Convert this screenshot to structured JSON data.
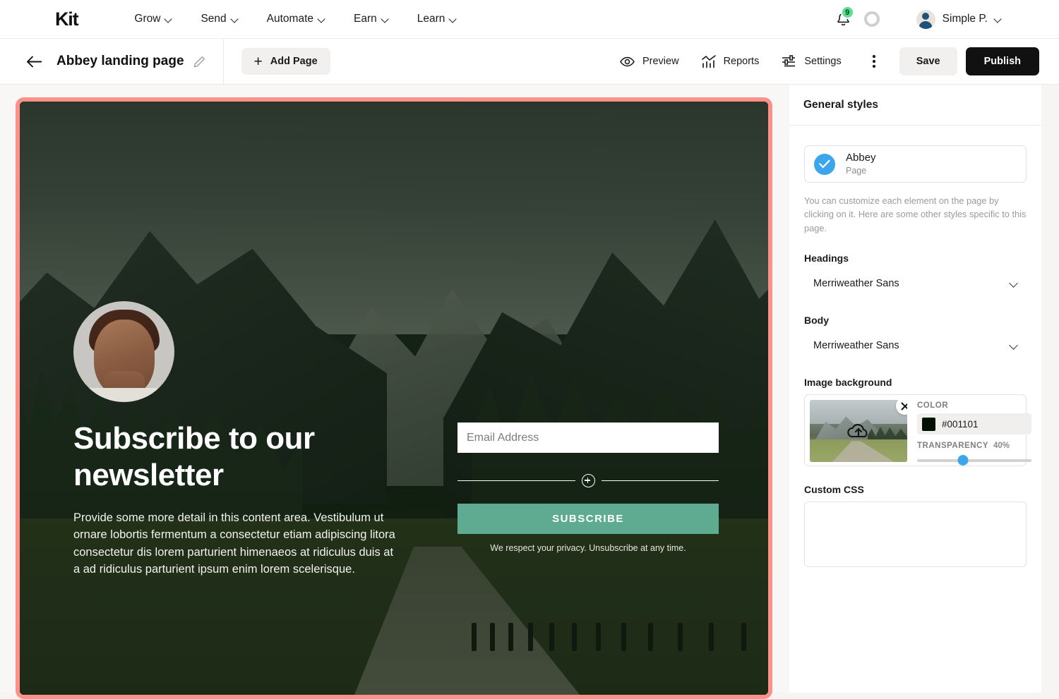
{
  "topnav": {
    "brand": "Kit",
    "menu": [
      {
        "label": "Grow",
        "icon": "chevron-down-icon"
      },
      {
        "label": "Send",
        "icon": "chevron-down-icon"
      },
      {
        "label": "Automate",
        "icon": "chevron-down-icon"
      },
      {
        "label": "Earn",
        "icon": "chevron-down-icon"
      },
      {
        "label": "Learn",
        "icon": "chevron-down-icon"
      }
    ],
    "notifications": {
      "icon": "bell-icon",
      "badge_count": "9",
      "badge_color": "#55e08e"
    },
    "progress_ring": {
      "icon": "progress-ring-icon"
    },
    "user": {
      "name": "Simple P.",
      "icon": "user-avatar-icon",
      "chevron": "chevron-down-icon"
    }
  },
  "subheader": {
    "back_icon": "back-arrow-icon",
    "page_title": "Abbey landing page",
    "edit_icon": "pencil-icon",
    "add_page_label": "Add Page",
    "add_page_icon": "plus-icon",
    "tools": [
      {
        "label": "Preview",
        "icon": "eye-icon"
      },
      {
        "label": "Reports",
        "icon": "bar-chart-icon"
      },
      {
        "label": "Settings",
        "icon": "sliders-icon"
      }
    ],
    "more_icon": "kebab-menu-icon",
    "save_label": "Save",
    "publish_label": "Publish"
  },
  "canvas": {
    "selection_color": "#fb9189",
    "hero": {
      "heading": "Subscribe to our newsletter",
      "body": "Provide some more detail in this content area. Vestibulum ut ornare lobortis fermentum a consectetur etiam adipiscing litora consectetur dis lorem parturient himenaeos at ridiculus duis at a ad ridiculus parturient ipsum enim lorem scelerisque.",
      "avatar_icon": "portrait-avatar-icon",
      "form": {
        "email_placeholder": "Email Address",
        "email_value": "",
        "add_field_icon": "plus-circle-icon",
        "submit_label": "SUBSCRIBE",
        "submit_color": "#5fab91",
        "privacy_text": "We respect your privacy. Unsubscribe at any time."
      }
    }
  },
  "panel": {
    "title": "General styles",
    "page_card": {
      "name": "Abbey",
      "type": "Page",
      "icon": "check-circle-icon",
      "icon_color": "#3ba6ec"
    },
    "hint": "You can customize each element on the page by clicking on it. Here are some other styles specific to this page.",
    "headings": {
      "label": "Headings",
      "value": "Merriweather Sans",
      "chevron": "chevron-down-icon"
    },
    "body_font": {
      "label": "Body",
      "value": "Merriweather Sans",
      "chevron": "chevron-down-icon"
    },
    "image_background": {
      "label": "Image background",
      "thumb_icon": "upload-cloud-icon",
      "remove_icon": "close-x-icon",
      "color_label": "COLOR",
      "color_value": "#001101",
      "transparency_label": "TRANSPARENCY",
      "transparency_value": "40%",
      "slider_accent": "#3ba6ec"
    },
    "custom_css": {
      "label": "Custom CSS",
      "value": "",
      "placeholder": ""
    }
  }
}
